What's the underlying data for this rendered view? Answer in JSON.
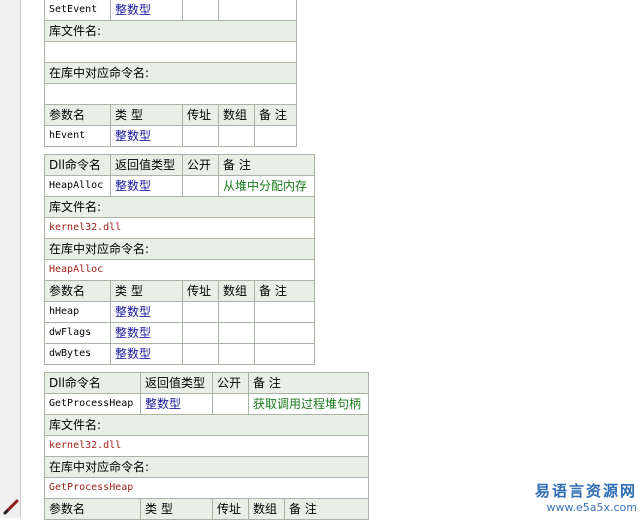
{
  "table_headers": {
    "dll_name": "Dll命令名",
    "return_type": "返回值类型",
    "public": "公开",
    "note": "备 注",
    "lib_file": "库文件名:",
    "lib_cmd": "在库中对应命令名:",
    "param_name": "参数名",
    "type": "类 型",
    "byref": "传址",
    "array": "数组"
  },
  "block1": {
    "first_row": {
      "name": "SetEvent",
      "type": "整数型"
    },
    "params": [
      {
        "name": "hEvent",
        "type": "整数型"
      }
    ]
  },
  "block2": {
    "command": {
      "name": "HeapAlloc",
      "type": "整数型",
      "note": "从堆中分配内存"
    },
    "lib_file": "kernel32.dll",
    "lib_cmd": "HeapAlloc",
    "params": [
      {
        "name": "hHeap",
        "type": "整数型"
      },
      {
        "name": "dwFlags",
        "type": "整数型"
      },
      {
        "name": "dwBytes",
        "type": "整数型"
      }
    ]
  },
  "block3": {
    "command": {
      "name": "GetProcessHeap",
      "type": "整数型",
      "note": "获取调用过程堆句柄"
    },
    "lib_file": "kernel32.dll",
    "lib_cmd": "GetProcessHeap"
  },
  "watermark": {
    "cn": "易语言资源网",
    "url": "www.e5a5x.com"
  },
  "icons": {
    "pen": "pencil-icon"
  }
}
